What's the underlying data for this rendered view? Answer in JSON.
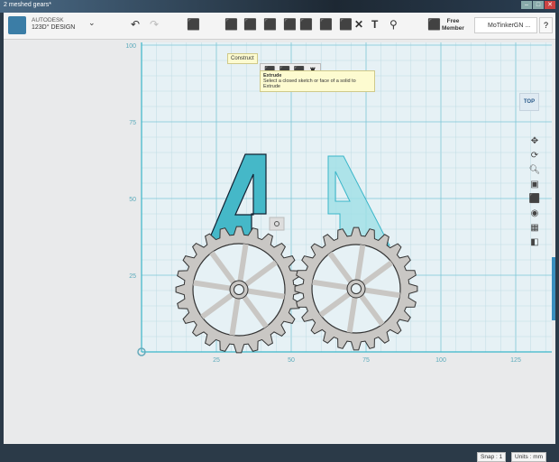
{
  "window": {
    "title": "2 meshed gears*"
  },
  "brand": {
    "line1": "AUTODESK",
    "line2": "123D° DESIGN"
  },
  "toolbar": {
    "icons": [
      "undo-icon",
      "redo-icon",
      "primitives-icon",
      "sketch-icon",
      "construct-icon",
      "modify-icon",
      "pattern-icon",
      "grouping-icon",
      "combine-icon",
      "delete-icon",
      "text-icon",
      "snap-icon",
      "materials-icon"
    ],
    "undo": "↶",
    "redo": "↷",
    "delete": "✕",
    "text": "T",
    "member": "Free\nMember",
    "member_line1": "Free",
    "member_line2": "Member",
    "user": "MoTinkerGN ...",
    "help": "?"
  },
  "construct": {
    "label": "Construct",
    "tooltip_title": "Extrude",
    "tooltip_text": "Select a closed sketch or face of a solid to Extrude"
  },
  "viewcube": {
    "label": "TOP"
  },
  "grid": {
    "x_ticks": [
      "25",
      "50",
      "75",
      "100",
      "125"
    ],
    "y_ticks": [
      "100",
      "75",
      "50",
      "25"
    ],
    "accent": "#3ab6c9"
  },
  "status": {
    "snap": "Snap : 1",
    "units": "Units : mm"
  }
}
